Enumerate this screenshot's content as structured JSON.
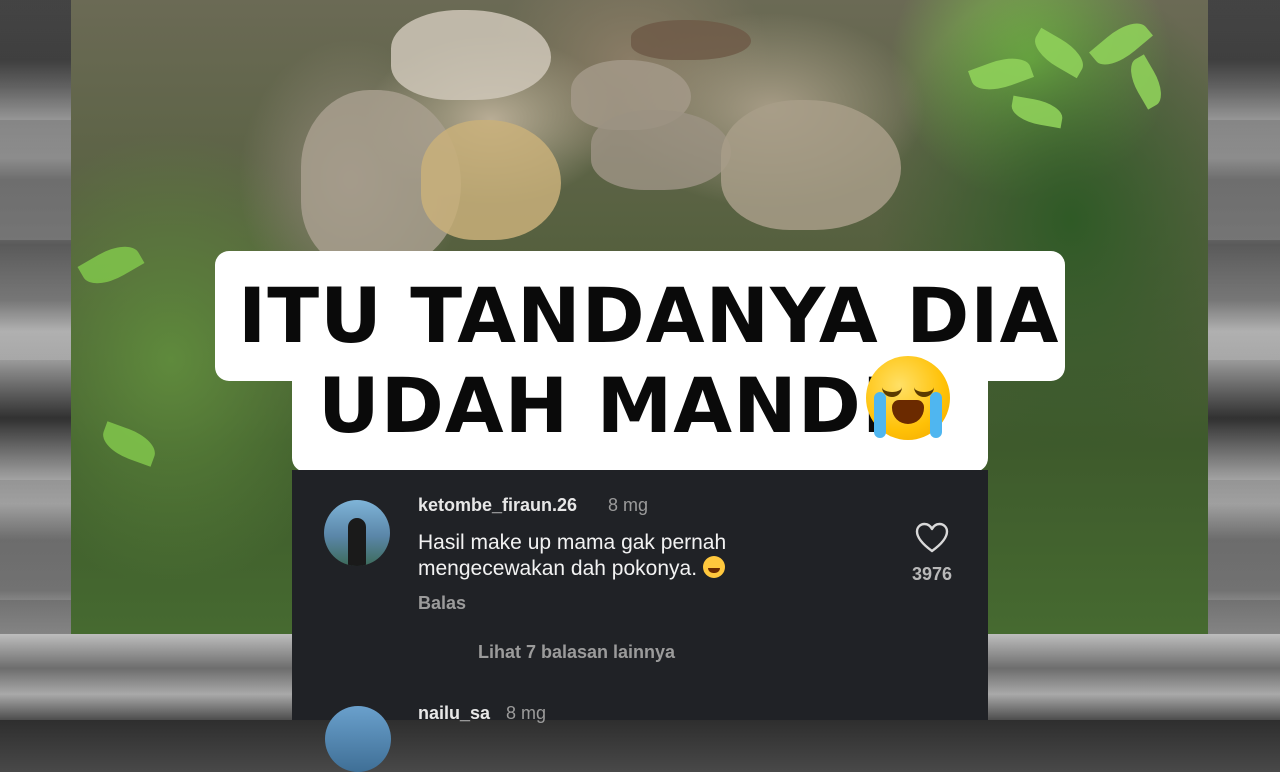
{
  "caption": {
    "line1": "ITU TANDANYA DIA",
    "line2": "UDAH MANDI",
    "emoji": "loudly-crying-face-emoji"
  },
  "comments": [
    {
      "username": "ketombe_firaun.26",
      "age": "8 mg",
      "text": "Hasil make up mama gak pernah mengecewakan dah pokonya.",
      "emoji": "joy-emoji",
      "likes": "3976",
      "reply_label": "Balas",
      "more_replies": "Lihat 7 balasan lainnya"
    },
    {
      "username": "nailu_sa",
      "age": "8 mg"
    }
  ],
  "colors": {
    "panel_bg": "#202226",
    "caption_bg": "#ffffff",
    "caption_text": "#0a0a0a"
  }
}
